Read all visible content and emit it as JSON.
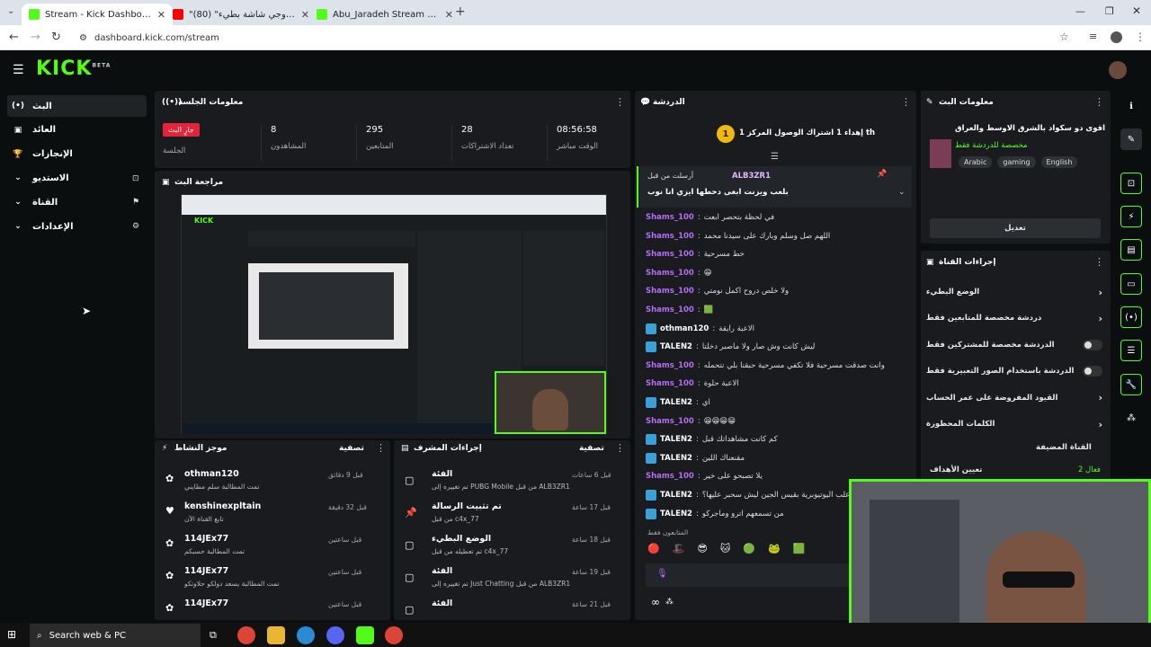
{
  "browser": {
    "tabs": [
      {
        "title": "Stream - Kick Dashboard",
        "active": true,
        "color": "#53fc18"
      },
      {
        "title": "\"بروجي شاشة بطيء\" (80) - YouTube",
        "active": false,
        "color": "#ff0000"
      },
      {
        "title": "Abu_Jaradeh Stream - Watch Live",
        "active": false,
        "color": "#53fc18"
      }
    ],
    "new_tab": "+",
    "url": "dashboard.kick.com/stream"
  },
  "header": {
    "logo": "KICK",
    "logo_sup": "BETA"
  },
  "sidebar": {
    "items": [
      {
        "label": "البث",
        "icon": "(•)"
      },
      {
        "label": "العائد",
        "icon": "▣"
      },
      {
        "label": "الإنجازات",
        "icon": "🏆"
      },
      {
        "label": "الاستديو",
        "icon": "⌄"
      },
      {
        "label": "القناة",
        "icon": "⌄"
      },
      {
        "label": "الإعدادات",
        "icon": "⌄"
      }
    ]
  },
  "session": {
    "title": "معلومات الجلسة",
    "live_badge": "جارٍ البث",
    "live_label": "الجلسة",
    "stats": [
      {
        "value": "8",
        "label": "المشاهدون"
      },
      {
        "value": "295",
        "label": "المتابعين"
      },
      {
        "value": "28",
        "label": "تعداد الاشتراكات"
      },
      {
        "value": "08:56:58",
        "label": "الوقت مباشر"
      }
    ]
  },
  "preview": {
    "title": "مراجعة البث"
  },
  "activity": {
    "title": "موجز النشاط",
    "filter": "تصفية",
    "items": [
      {
        "name": "othman120",
        "sub": "تمت المطالبة سلم مطايني",
        "time": "قبل 9 دقائق"
      },
      {
        "name": "kenshinexpltain",
        "sub": "تابع القناة الآن",
        "time": "قبل 32 دقيقة"
      },
      {
        "name": "114JEx77",
        "sub": "تمت المطالبة حسبكم",
        "time": "قبل ساعتين"
      },
      {
        "name": "114JEx77",
        "sub": "تمت المطالبة يسعد دولكو حلاوتكو",
        "time": "قبل ساعتين"
      },
      {
        "name": "114JEx77",
        "sub": "",
        "time": "قبل ساعتين"
      }
    ]
  },
  "modactions": {
    "title": "إجراءات المشرف",
    "filter": "تصفية",
    "items": [
      {
        "title": "الفئة",
        "sub": "تم تغييره إلى PUBG Mobile من قبل ALB3ZR1",
        "time": "قبل 6 ساعات"
      },
      {
        "title": "تم تثبيت الرسالة",
        "sub": "من قبل c4x_77",
        "time": "قبل 17 ساعة"
      },
      {
        "title": "الوضع البطيء",
        "sub": "تم تعطيله من قبل c4x_77",
        "time": "قبل 18 ساعة"
      },
      {
        "title": "الفئة",
        "sub": "تم تغييره إلى Just Chatting من قبل ALB3ZR1",
        "time": "قبل 19 ساعة"
      },
      {
        "title": "الفئة",
        "sub": "",
        "time": "قبل 21 ساعة"
      }
    ]
  },
  "chat": {
    "title": "الدردشة",
    "goal": "إهداء 1 اشتراك الوصول المركز 1 th",
    "goal_rank": "1",
    "pinned_user": "ALB3ZR1",
    "pinned_by": "أرسلت من قبل",
    "pinned_text": "بلعب ويزنت ابغى دحطها ايزي انا نوب",
    "messages": [
      {
        "user": "Shams_100",
        "text": "في لحظة بتحصر ابعت",
        "color": "#b66cf3"
      },
      {
        "user": "Shams_100",
        "text": "اللهم صل وسلم وبارك على سيدنا محمد",
        "color": "#b66cf3"
      },
      {
        "user": "Shams_100",
        "text": "خط مسرحية",
        "color": "#b66cf3"
      },
      {
        "user": "Shams_100",
        "text": "😁",
        "color": "#b66cf3"
      },
      {
        "user": "Shams_100",
        "text": "ولا خلص دروح اكمل نومتي",
        "color": "#b66cf3"
      },
      {
        "user": "Shams_100",
        "text": "🟩",
        "color": "#b66cf3"
      },
      {
        "user": "othman120",
        "text": "الاعبة رايقة",
        "color": "#ffffff"
      },
      {
        "user": "TALEN2",
        "text": "ليش كانت وش صار ولا ماصبر دخلتا",
        "color": "#ffffff"
      },
      {
        "user": "Shams_100",
        "text": "وانت صدقت مسرحية فلا تكفي مسرحية حبقنا بلي نتحمله",
        "color": "#b66cf3"
      },
      {
        "user": "Shams_100",
        "text": "الاعبة حلوة",
        "color": "#b66cf3"
      },
      {
        "user": "TALEN2",
        "text": "اي",
        "color": "#ffffff"
      },
      {
        "user": "Shams_100",
        "text": "😁😁😁😁",
        "color": "#b66cf3"
      },
      {
        "user": "TALEN2",
        "text": "كم كانت مشاهداتك قبل",
        "color": "#ffffff"
      },
      {
        "user": "TALEN2",
        "text": "مقنعناك اللين",
        "color": "#ffffff"
      },
      {
        "user": "Shams_100",
        "text": "يلا تصبحو على خير",
        "color": "#b66cf3"
      },
      {
        "user": "TALEN2",
        "text": "كان اعلب اليوتيوبرية بقيس الجين ليش سحبر عليها؟",
        "color": "#ffffff"
      },
      {
        "user": "TALEN2",
        "text": "من تسمعهم اترو وماجركو",
        "color": "#ffffff"
      }
    ],
    "followers_only": "المتابعون فقط"
  },
  "streaminfo": {
    "title": "معلومات البث",
    "stream_title": "اقوى دو سكواد بالشرق الاوسط والعراق",
    "subtitle": "مخصصة للدردشة فقط",
    "tags": [
      "Arabic",
      "gaming",
      "English"
    ],
    "edit": "تعديل"
  },
  "channelactions": {
    "title": "إجراءات القناة",
    "items": [
      {
        "label": "الوضع البطيء",
        "control": "chevron"
      },
      {
        "label": "دردشة مخصصة للمتابعين فقط",
        "control": "chevron"
      },
      {
        "label": "الدردشة مخصصة للمشتركين فقط",
        "control": "toggle"
      },
      {
        "label": "الدردشة باستخدام الصور التعبيرية فقط",
        "control": "toggle"
      },
      {
        "label": "القيود المفروضة على عمر الحساب",
        "control": "chevron"
      },
      {
        "label": "الكلمات المحظورة",
        "control": "chevron"
      }
    ],
    "hosted": "القناة المضيفة",
    "goals": "تعيين الأهداف",
    "goals_val": "فعال 2"
  },
  "taskbar": {
    "search": "Search web & PC"
  }
}
